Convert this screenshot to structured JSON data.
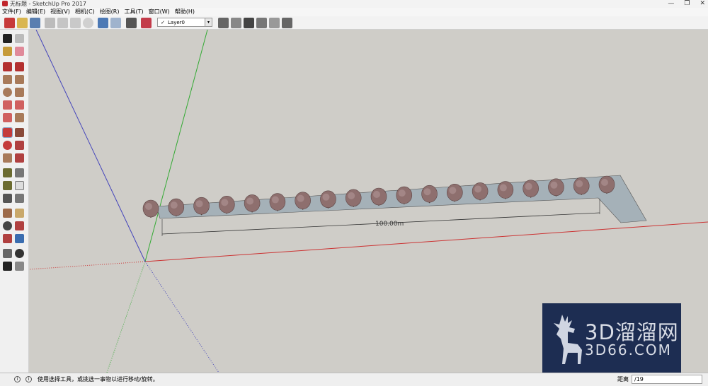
{
  "window": {
    "title": "无标题 - SketchUp Pro 2017",
    "controls": [
      "—",
      "❐",
      "✕"
    ]
  },
  "menu": [
    "文件(F)",
    "编辑(E)",
    "视图(V)",
    "相机(C)",
    "绘图(R)",
    "工具(T)",
    "窗口(W)",
    "帮助(H)"
  ],
  "layers": {
    "current": "Layer0",
    "checkmark": "✓",
    "dropdown_arrow": "▾"
  },
  "viewport": {
    "dimension_label": "100.00m",
    "tree_count": 19
  },
  "status": {
    "icon1": "i",
    "icon2": "i",
    "message": "使用选择工具，或挑选一事物以进行移动/旋转。",
    "measure_label": "距离",
    "measure_value": "/19"
  },
  "watermark": {
    "line1": "3D溜溜网",
    "line2": "3D66.COM"
  },
  "colors": {
    "red_axis": "#cc3333",
    "green_axis": "#33aa33",
    "blue_axis": "#4444bb",
    "path_fill": "#a5b1b8"
  }
}
